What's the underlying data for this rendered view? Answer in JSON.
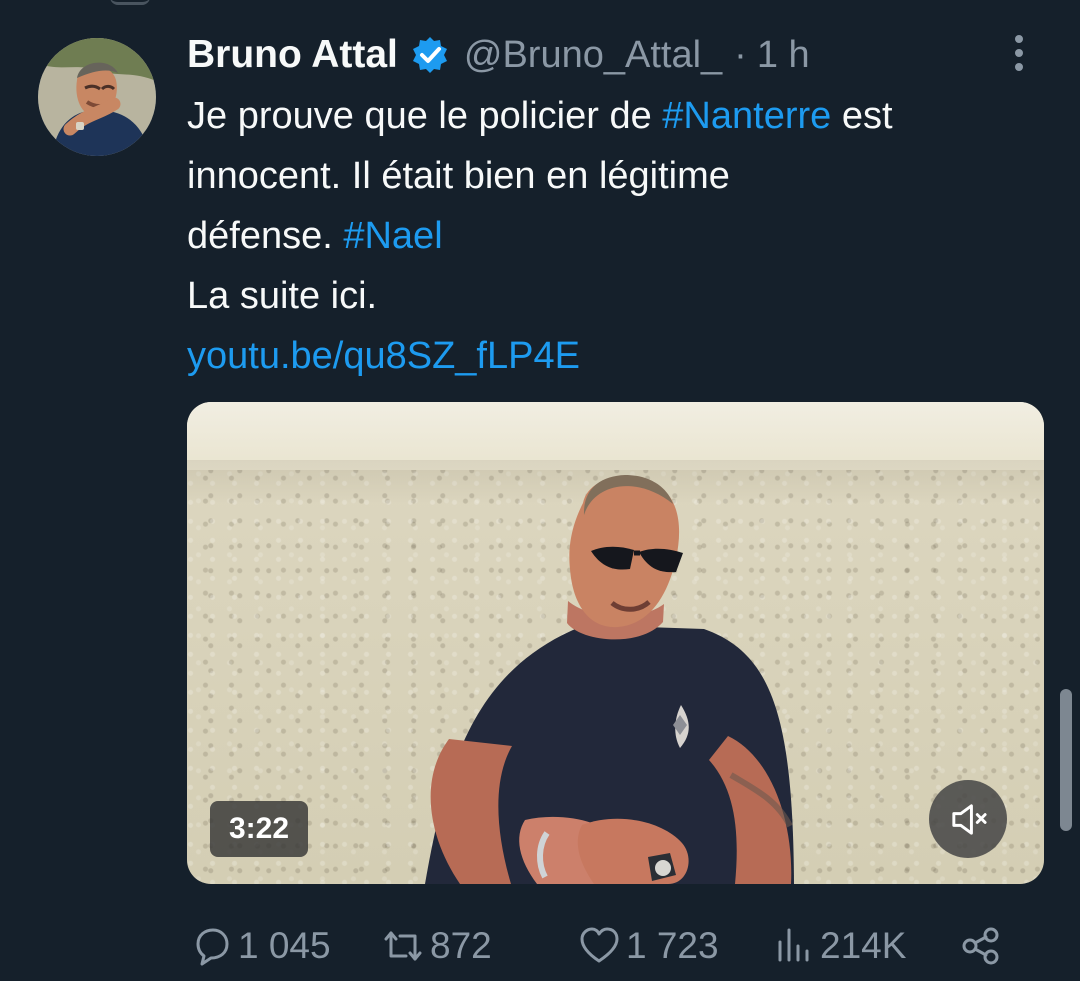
{
  "tweet": {
    "author": {
      "name": "Bruno Attal",
      "handle": "@Bruno_Attal_",
      "separator": "·",
      "time": "1 h"
    },
    "text": {
      "line1_before": "Je prouve que le policier de ",
      "hashtag_nanterre": "#Nanterre",
      "line1_after": " est",
      "line2": "innocent. Il était bien en légitime",
      "line3_before": "défense. ",
      "hashtag_nael": "#Nael",
      "line4": "La suite ici.",
      "link": "youtu.be/qu8SZ_fLP4E"
    },
    "video": {
      "duration": "3:22"
    },
    "actions": {
      "replies": "1 045",
      "retweets": "872",
      "likes": "1 723",
      "views": "214K"
    }
  },
  "colors": {
    "background": "#15202b",
    "text": "#f7f9f9",
    "secondary_text": "#8b98a5",
    "accent": "#1d9bf0"
  },
  "icons": [
    "verified-badge-icon",
    "more-options-icon",
    "muted-speaker-icon",
    "reply-icon",
    "retweet-icon",
    "like-icon",
    "views-icon",
    "share-icon"
  ]
}
